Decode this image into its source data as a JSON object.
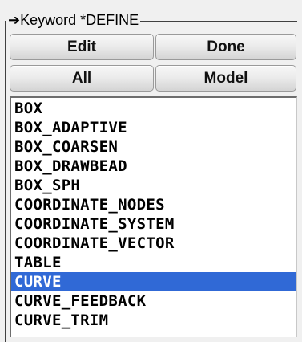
{
  "panel": {
    "title": "➔Keyword *DEFINE"
  },
  "buttons": {
    "edit": "Edit",
    "done": "Done",
    "all": "All",
    "model": "Model"
  },
  "list": {
    "selected": "CURVE",
    "items": [
      "BOX",
      "BOX_ADAPTIVE",
      "BOX_COARSEN",
      "BOX_DRAWBEAD",
      "BOX_SPH",
      "COORDINATE_NODES",
      "COORDINATE_SYSTEM",
      "COORDINATE_VECTOR",
      "TABLE",
      "CURVE",
      "CURVE_FEEDBACK",
      "CURVE_TRIM"
    ]
  },
  "colors": {
    "selection": "#3069d6",
    "selection_text": "#ffffff"
  }
}
